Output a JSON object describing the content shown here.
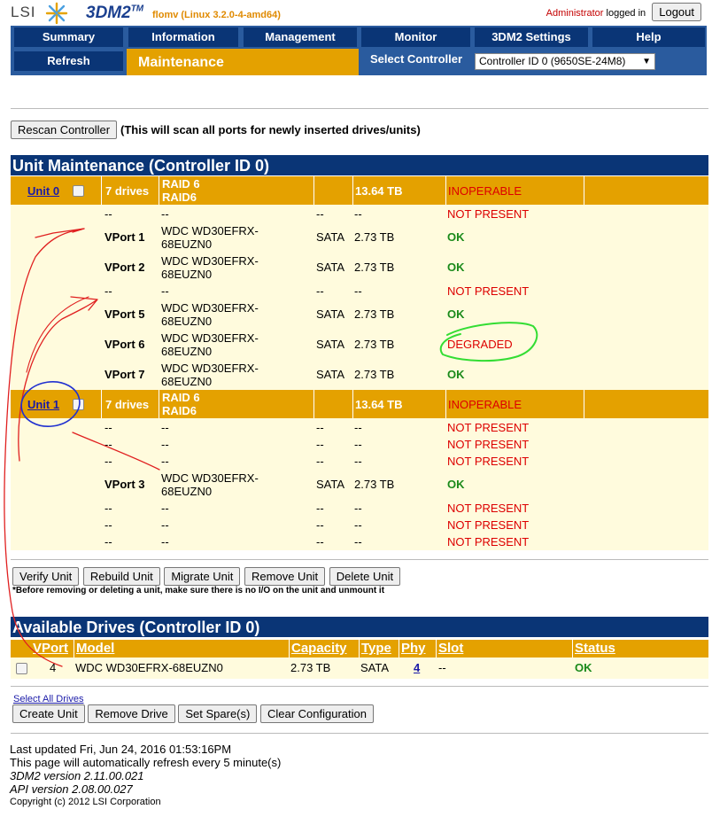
{
  "app": {
    "logo_text": "LSI",
    "product": "3DM2",
    "trademark": "TM",
    "host": "flomv (Linux 3.2.0-4-amd64)"
  },
  "user": {
    "name": "Administrator",
    "logged_in_text": "logged in",
    "logout_label": "Logout"
  },
  "nav": {
    "tabs": [
      "Summary",
      "Information",
      "Management",
      "Monitor",
      "3DM2 Settings",
      "Help"
    ],
    "refresh_label": "Refresh",
    "active_page": "Maintenance",
    "select_controller_label": "Select Controller",
    "controller_value": "Controller ID 0 (9650SE-24M8)"
  },
  "rescan": {
    "button_label": "Rescan Controller",
    "note": "(This will scan all ports for newly inserted drives/units)"
  },
  "unit_maintenance": {
    "title": "Unit Maintenance (Controller ID 0)",
    "units": [
      {
        "name": "Unit 0",
        "drives": "7 drives",
        "raid_line1": "RAID 6",
        "raid_line2": "RAID6",
        "capacity": "13.64 TB",
        "status": "INOPERABLE",
        "ports": [
          {
            "vport": "--",
            "model1": "--",
            "model2": "",
            "type": "--",
            "capacity": "--",
            "status": "NOT PRESENT"
          },
          {
            "vport": "VPort 1",
            "model1": "WDC WD30EFRX-",
            "model2": "68EUZN0",
            "type": "SATA",
            "capacity": "2.73 TB",
            "status": "OK"
          },
          {
            "vport": "VPort 2",
            "model1": "WDC WD30EFRX-",
            "model2": "68EUZN0",
            "type": "SATA",
            "capacity": "2.73 TB",
            "status": "OK"
          },
          {
            "vport": "--",
            "model1": "--",
            "model2": "",
            "type": "--",
            "capacity": "--",
            "status": "NOT PRESENT"
          },
          {
            "vport": "VPort 5",
            "model1": "WDC WD30EFRX-",
            "model2": "68EUZN0",
            "type": "SATA",
            "capacity": "2.73 TB",
            "status": "OK"
          },
          {
            "vport": "VPort 6",
            "model1": "WDC WD30EFRX-",
            "model2": "68EUZN0",
            "type": "SATA",
            "capacity": "2.73 TB",
            "status": "DEGRADED"
          },
          {
            "vport": "VPort 7",
            "model1": "WDC WD30EFRX-",
            "model2": "68EUZN0",
            "type": "SATA",
            "capacity": "2.73 TB",
            "status": "OK"
          }
        ]
      },
      {
        "name": "Unit 1",
        "drives": "7 drives",
        "raid_line1": "RAID 6",
        "raid_line2": "RAID6",
        "capacity": "13.64 TB",
        "status": "INOPERABLE",
        "ports": [
          {
            "vport": "--",
            "model1": "--",
            "model2": "",
            "type": "--",
            "capacity": "--",
            "status": "NOT PRESENT"
          },
          {
            "vport": "--",
            "model1": "--",
            "model2": "",
            "type": "--",
            "capacity": "--",
            "status": "NOT PRESENT"
          },
          {
            "vport": "--",
            "model1": "--",
            "model2": "",
            "type": "--",
            "capacity": "--",
            "status": "NOT PRESENT"
          },
          {
            "vport": "VPort 3",
            "model1": "WDC WD30EFRX-",
            "model2": "68EUZN0",
            "type": "SATA",
            "capacity": "2.73 TB",
            "status": "OK"
          },
          {
            "vport": "--",
            "model1": "--",
            "model2": "",
            "type": "--",
            "capacity": "--",
            "status": "NOT PRESENT"
          },
          {
            "vport": "--",
            "model1": "--",
            "model2": "",
            "type": "--",
            "capacity": "--",
            "status": "NOT PRESENT"
          },
          {
            "vport": "--",
            "model1": "--",
            "model2": "",
            "type": "--",
            "capacity": "--",
            "status": "NOT PRESENT"
          }
        ]
      }
    ],
    "buttons": [
      "Verify Unit",
      "Rebuild Unit",
      "Migrate Unit",
      "Remove Unit",
      "Delete Unit"
    ],
    "warning": "*Before removing or deleting a unit, make sure there is no I/O on the unit and unmount it"
  },
  "available_drives": {
    "title": "Available Drives (Controller ID 0)",
    "columns": [
      "VPort",
      "Model",
      "Capacity",
      "Type",
      "Phy",
      "Slot",
      "Status"
    ],
    "rows": [
      {
        "vport": "4",
        "model": "WDC WD30EFRX-68EUZN0",
        "capacity": "2.73 TB",
        "type": "SATA",
        "phy": "4",
        "slot": "--",
        "status": "OK"
      }
    ],
    "select_all_label": "Select All Drives",
    "buttons": [
      "Create Unit",
      "Remove Drive",
      "Set Spare(s)",
      "Clear Configuration"
    ]
  },
  "footer": {
    "last_updated": "Last updated Fri, Jun 24, 2016 01:53:16PM",
    "refresh_note": "This page will automatically refresh every 5 minute(s)",
    "version": "3DM2 version 2.11.00.021",
    "api_version": "API version 2.08.00.027",
    "copyright": "Copyright (c) 2012 LSI Corporation"
  },
  "colors": {
    "nav_blue": "#0a3576",
    "nav_bg": "#2a5b9e",
    "accent_gold": "#e4a100",
    "row_cream": "#fffbdd",
    "ok_green": "#1a8a1a",
    "error_red": "#dd0000",
    "annotation_red": "#e02020",
    "annotation_green": "#33dd33",
    "annotation_blue": "#2030d0"
  }
}
